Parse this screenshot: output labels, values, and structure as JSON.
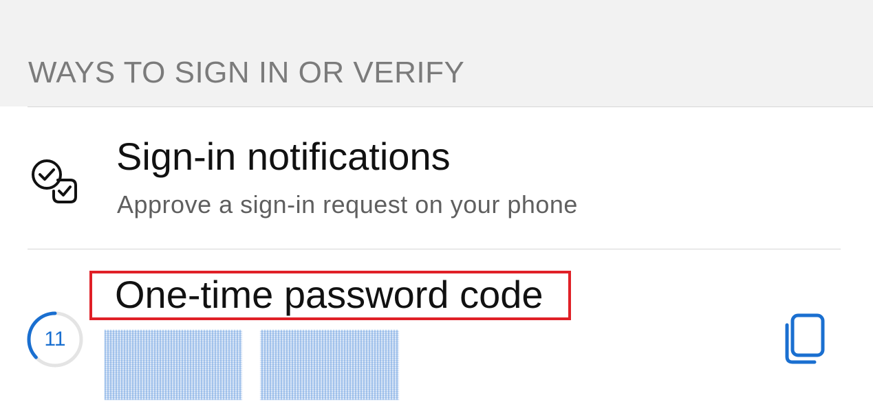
{
  "section": {
    "header": "WAYS TO SIGN IN OR VERIFY"
  },
  "sign_in_notifications": {
    "icon": "check-badges-icon",
    "title": "Sign-in notifications",
    "subtitle": "Approve a sign-in request on your phone"
  },
  "otp": {
    "timer_value": "11",
    "timer_fraction_remaining": 0.37,
    "title": "One-time password code",
    "copy_icon": "copy-icon"
  },
  "colors": {
    "accent": "#1a6fd0",
    "highlight_box": "#e02027",
    "header_background": "#f2f2f2",
    "header_text": "#7b7b7b"
  }
}
